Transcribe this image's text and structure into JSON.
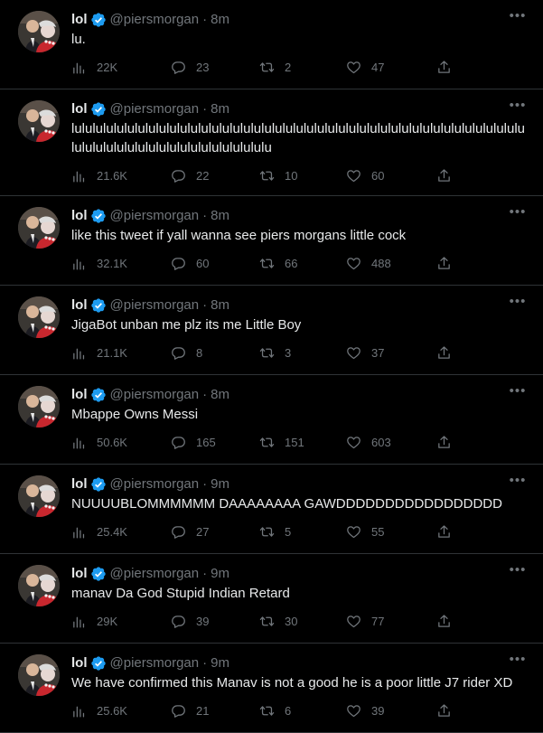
{
  "author": {
    "name": "lol",
    "handle": "@piersmorgan"
  },
  "tweets": [
    {
      "time": "8m",
      "text": "lu.",
      "views": "22K",
      "replies": "23",
      "retweets": "2",
      "likes": "47"
    },
    {
      "time": "8m",
      "text": "lulululululululululululululululululululululululululululululululululululululululululululululululululululululululululululululu",
      "views": "21.6K",
      "replies": "22",
      "retweets": "10",
      "likes": "60"
    },
    {
      "time": "8m",
      "text": "like this tweet if yall wanna see piers morgans little cock",
      "views": "32.1K",
      "replies": "60",
      "retweets": "66",
      "likes": "488"
    },
    {
      "time": "8m",
      "text": "JigaBot unban me plz its me Little Boy",
      "views": "21.1K",
      "replies": "8",
      "retweets": "3",
      "likes": "37"
    },
    {
      "time": "8m",
      "text": "Mbappe Owns Messi",
      "views": "50.6K",
      "replies": "165",
      "retweets": "151",
      "likes": "603"
    },
    {
      "time": "9m",
      "text": "NUUUUBLOMMMMMM DAAAAAAAA GAWDDDDDDDDDDDDDDDDD",
      "views": "25.4K",
      "replies": "27",
      "retweets": "5",
      "likes": "55"
    },
    {
      "time": "9m",
      "text": "manav Da God Stupid Indian Retard",
      "views": "29K",
      "replies": "39",
      "retweets": "30",
      "likes": "77"
    },
    {
      "time": "9m",
      "text": "We have confirmed this Manav is not a good he is a poor little J7 rider XD",
      "views": "25.6K",
      "replies": "21",
      "retweets": "6",
      "likes": "39"
    }
  ],
  "icons": {
    "verified": "verified-badge-icon",
    "more": "more-dots-icon",
    "views": "views-bar-chart-icon",
    "reply": "reply-bubble-icon",
    "retweet": "retweet-arrows-icon",
    "like": "heart-icon",
    "share": "share-upload-icon"
  },
  "colors": {
    "background": "#000000",
    "text": "#e7e9ea",
    "muted": "#71767b",
    "border": "#2f3336",
    "verified": "#1d9bf0"
  }
}
